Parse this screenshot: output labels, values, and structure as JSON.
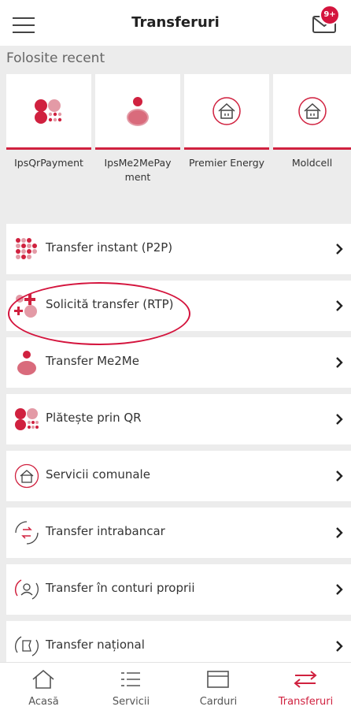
{
  "header": {
    "title": "Transferuri",
    "badge": "9+"
  },
  "recent": {
    "heading": "Folosite recent",
    "items": [
      {
        "label": "IpsQrPayment",
        "icon": "qr-dots-icon"
      },
      {
        "label": "IpsMe2MePay ment",
        "icon": "person-icon"
      },
      {
        "label": "Premier Energy",
        "icon": "house-icon"
      },
      {
        "label": "Moldcell",
        "icon": "house-icon"
      }
    ]
  },
  "list": [
    {
      "label": "Transfer instant (P2P)",
      "icon": "dots-grid-icon"
    },
    {
      "label": "Solicită transfer (RTP)",
      "icon": "request-plus-icon"
    },
    {
      "label": "Transfer Me2Me",
      "icon": "person-icon"
    },
    {
      "label": "Plătește prin QR",
      "icon": "qr-dots-icon"
    },
    {
      "label": "Servicii comunale",
      "icon": "house-icon"
    },
    {
      "label": "Transfer intrabancar",
      "icon": "swap-arrows-icon"
    },
    {
      "label": "Transfer în conturi proprii",
      "icon": "own-accounts-icon"
    },
    {
      "label": "Transfer național",
      "icon": "national-transfer-icon"
    }
  ],
  "nav": [
    {
      "label": "Acasă",
      "icon": "home-icon"
    },
    {
      "label": "Servicii",
      "icon": "list-icon"
    },
    {
      "label": "Carduri",
      "icon": "card-icon"
    },
    {
      "label": "Transferuri",
      "icon": "transfer-arrows-icon",
      "active": true
    }
  ],
  "colors": {
    "accent": "#d0213f",
    "pink": "#e39aa6",
    "background": "#ececec"
  }
}
